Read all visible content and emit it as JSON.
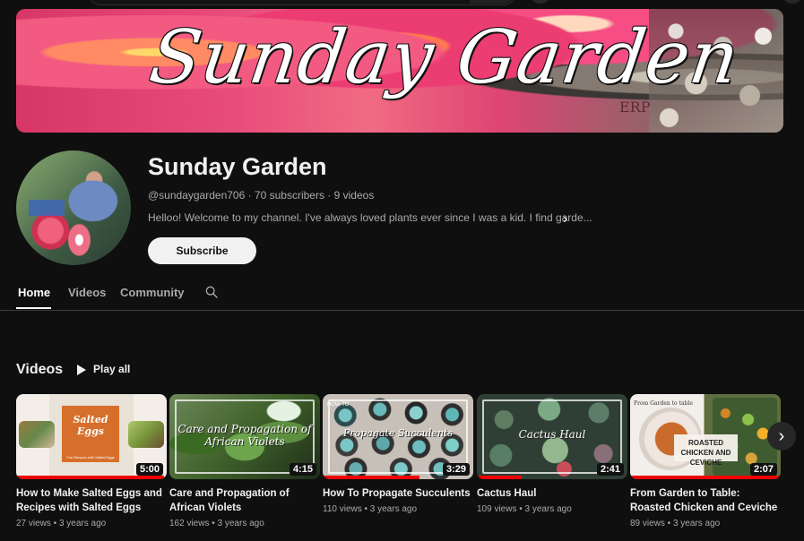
{
  "banner": {
    "title": "Sunday Garden",
    "watermark": "ERP"
  },
  "channel": {
    "name": "Sunday Garden",
    "meta": "@sundaygarden706 · 70 subscribers · 9 videos",
    "description": "Helloo! Welcome to my channel. I've always loved plants ever since I was a kid. I find garde...",
    "subscribe_label": "Subscribe"
  },
  "tabs": [
    {
      "label": "Home"
    },
    {
      "label": "Videos"
    },
    {
      "label": "Community"
    }
  ],
  "section": {
    "title": "Videos",
    "play_all": "Play all"
  },
  "videos": [
    {
      "title": "How to Make Salted Eggs and Recipes with Salted Eggs",
      "meta": "27 views • 3 years ago",
      "duration": "5:00",
      "thumb_text": "Salted Eggs",
      "thumb_subtext": "Fun Recipes with Salted Eggs"
    },
    {
      "title": "Care and Propagation of African Violets",
      "meta": "162 views • 3 years ago",
      "duration": "4:15",
      "thumb_text": "Care and Propagation of African Violets"
    },
    {
      "title": "How To Propagate Succulents",
      "meta": "110 views • 3 years ago",
      "duration": "3:29",
      "thumb_label": "HOW TO",
      "thumb_text": "Propagate Succulents"
    },
    {
      "title": "Cactus Haul",
      "meta": "109 views • 3 years ago",
      "duration": "2:41",
      "thumb_text": "Cactus Haul"
    },
    {
      "title": "From Garden to Table: Roasted Chicken and Ceviche",
      "meta": "89 views • 3 years ago",
      "duration": "2:07",
      "thumb_label": "From Garden to table",
      "thumb_text": "ROASTED CHICKEN AND CEVICHE"
    }
  ],
  "icons": {
    "search": "search-icon",
    "play": "play-icon",
    "chevron_right": "chevron-right-icon"
  },
  "colors": {
    "background": "#0f0f0f",
    "text": "#f1f1f1",
    "muted": "#aaaaaa",
    "accent": "#ee0000"
  }
}
